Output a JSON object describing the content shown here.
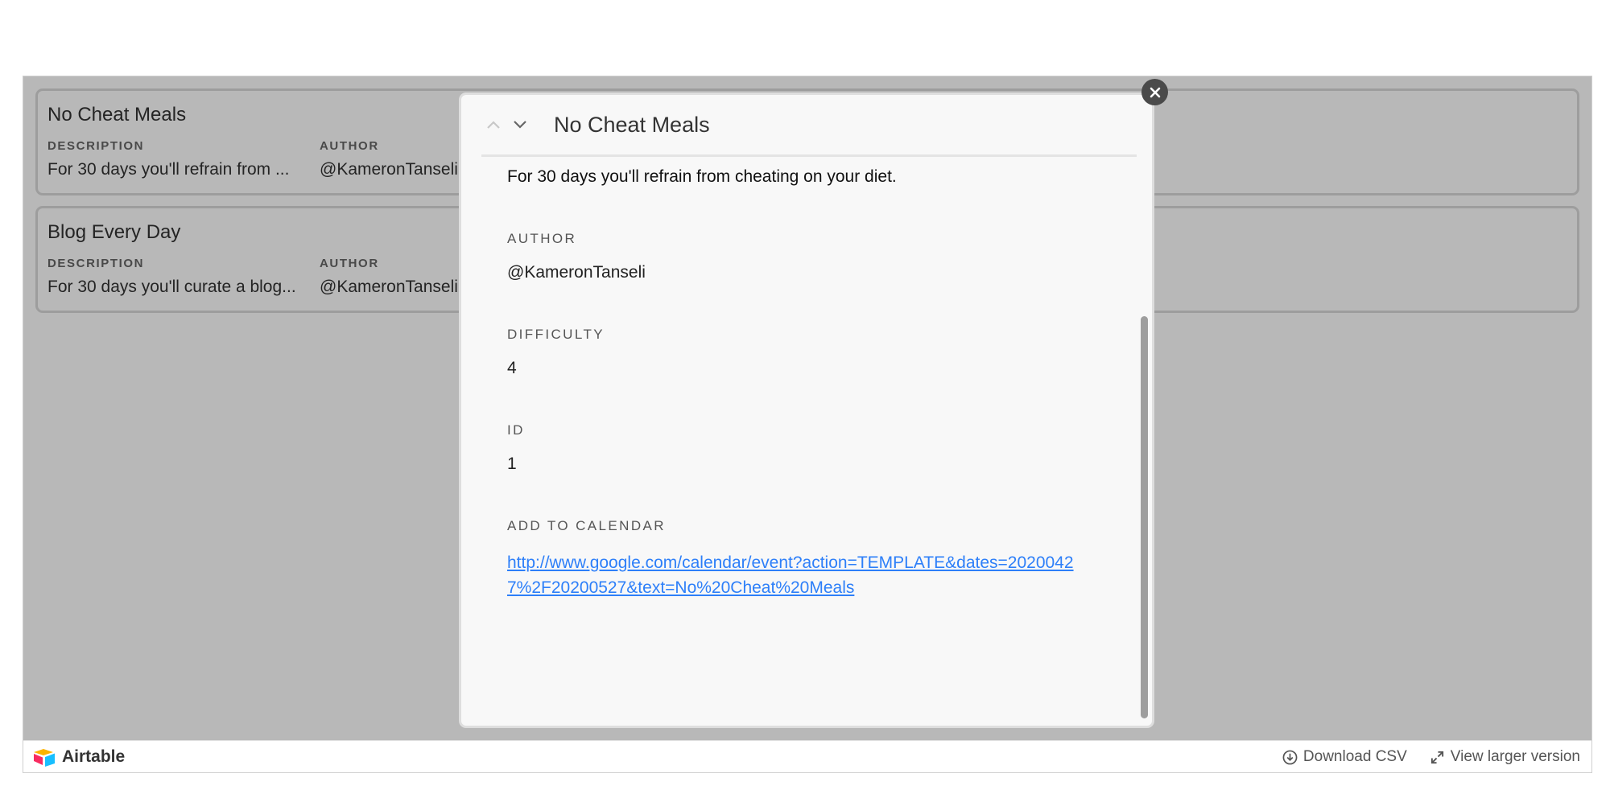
{
  "cards": [
    {
      "title": "No Cheat Meals",
      "fields": [
        {
          "label": "DESCRIPTION",
          "value": "For 30 days you'll refrain from ..."
        },
        {
          "label": "AUTHOR",
          "value": "@KameronTanseli"
        }
      ]
    },
    {
      "title": "Blog Every Day",
      "fields": [
        {
          "label": "DESCRIPTION",
          "value": "For 30 days you'll curate a blog..."
        },
        {
          "label": "AUTHOR",
          "value": "@KameronTanseli"
        }
      ]
    }
  ],
  "modal": {
    "title": "No Cheat Meals",
    "description": "For 30 days you'll refrain from cheating on your diet.",
    "fields": [
      {
        "label": "AUTHOR",
        "value": "@KameronTanseli"
      },
      {
        "label": "DIFFICULTY",
        "value": "4"
      },
      {
        "label": "ID",
        "value": "1"
      }
    ],
    "calendar": {
      "label": "ADD TO CALENDAR",
      "url": "http://www.google.com/calendar/event?action=TEMPLATE&dates=20200427%2F20200527&text=No%20Cheat%20Meals"
    }
  },
  "footer": {
    "brand": "Airtable",
    "download_label": "Download CSV",
    "view_larger_label": "View larger version"
  },
  "icons": {
    "up": "chevron-up-icon",
    "down": "chevron-down-icon",
    "close": "close-icon",
    "download": "download-icon",
    "expand": "expand-icon",
    "logo": "airtable-logo-icon"
  },
  "colors": {
    "link": "#2d7ff9",
    "overlay": "rgba(0,0,0,0.28)",
    "close_bg": "#4a4a4a"
  }
}
